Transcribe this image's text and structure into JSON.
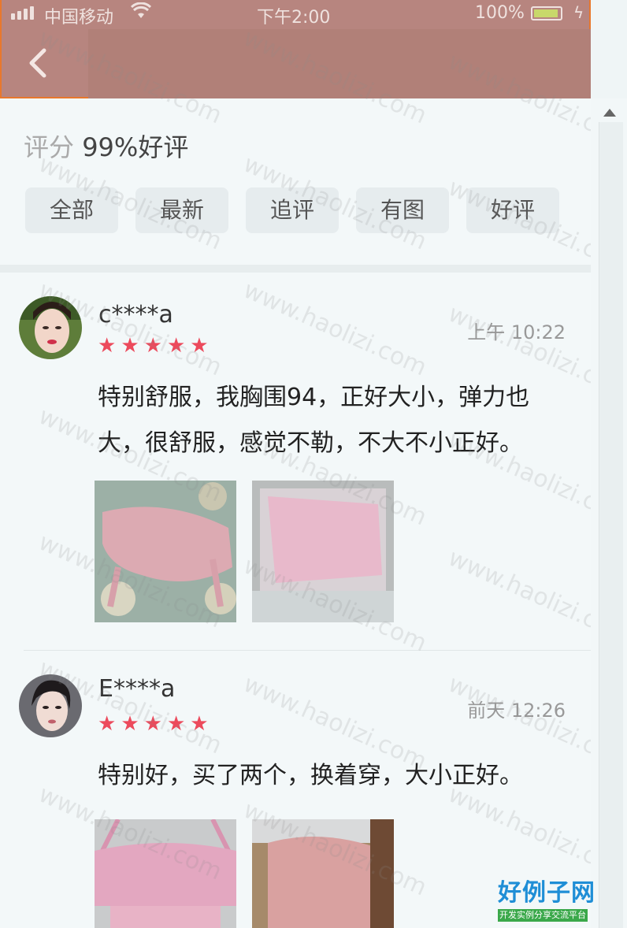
{
  "status_bar": {
    "carrier": "中国移动",
    "time": "下午2:00",
    "battery": "100%"
  },
  "summary": {
    "score_label": "评分",
    "score_value": "99%好评"
  },
  "filters": [
    "全部",
    "最新",
    "追评",
    "有图",
    "好评"
  ],
  "reviews": [
    {
      "user": "c****a",
      "time": "上午 10:22",
      "stars": 5,
      "text": "特别舒服，我胸围94，正好大小，弹力也大，很舒服，感觉不勒，不大不小正好。"
    },
    {
      "user": "E****a",
      "time": "前天 12:26",
      "stars": 5,
      "text": "特别好，买了两个，换着穿，大小正好。"
    }
  ],
  "watermark": {
    "text": "www.haolizi.com",
    "logo_title": "好例子网",
    "logo_sub": "开发实例分享交流平台"
  },
  "colors": {
    "header": "#b7857f",
    "star": "#ec4a5c",
    "header_border": "#e8782c"
  },
  "icons": {
    "back": "chevron-left-icon",
    "wifi": "wifi-icon",
    "signal": "signal-icon",
    "star": "star-icon"
  }
}
